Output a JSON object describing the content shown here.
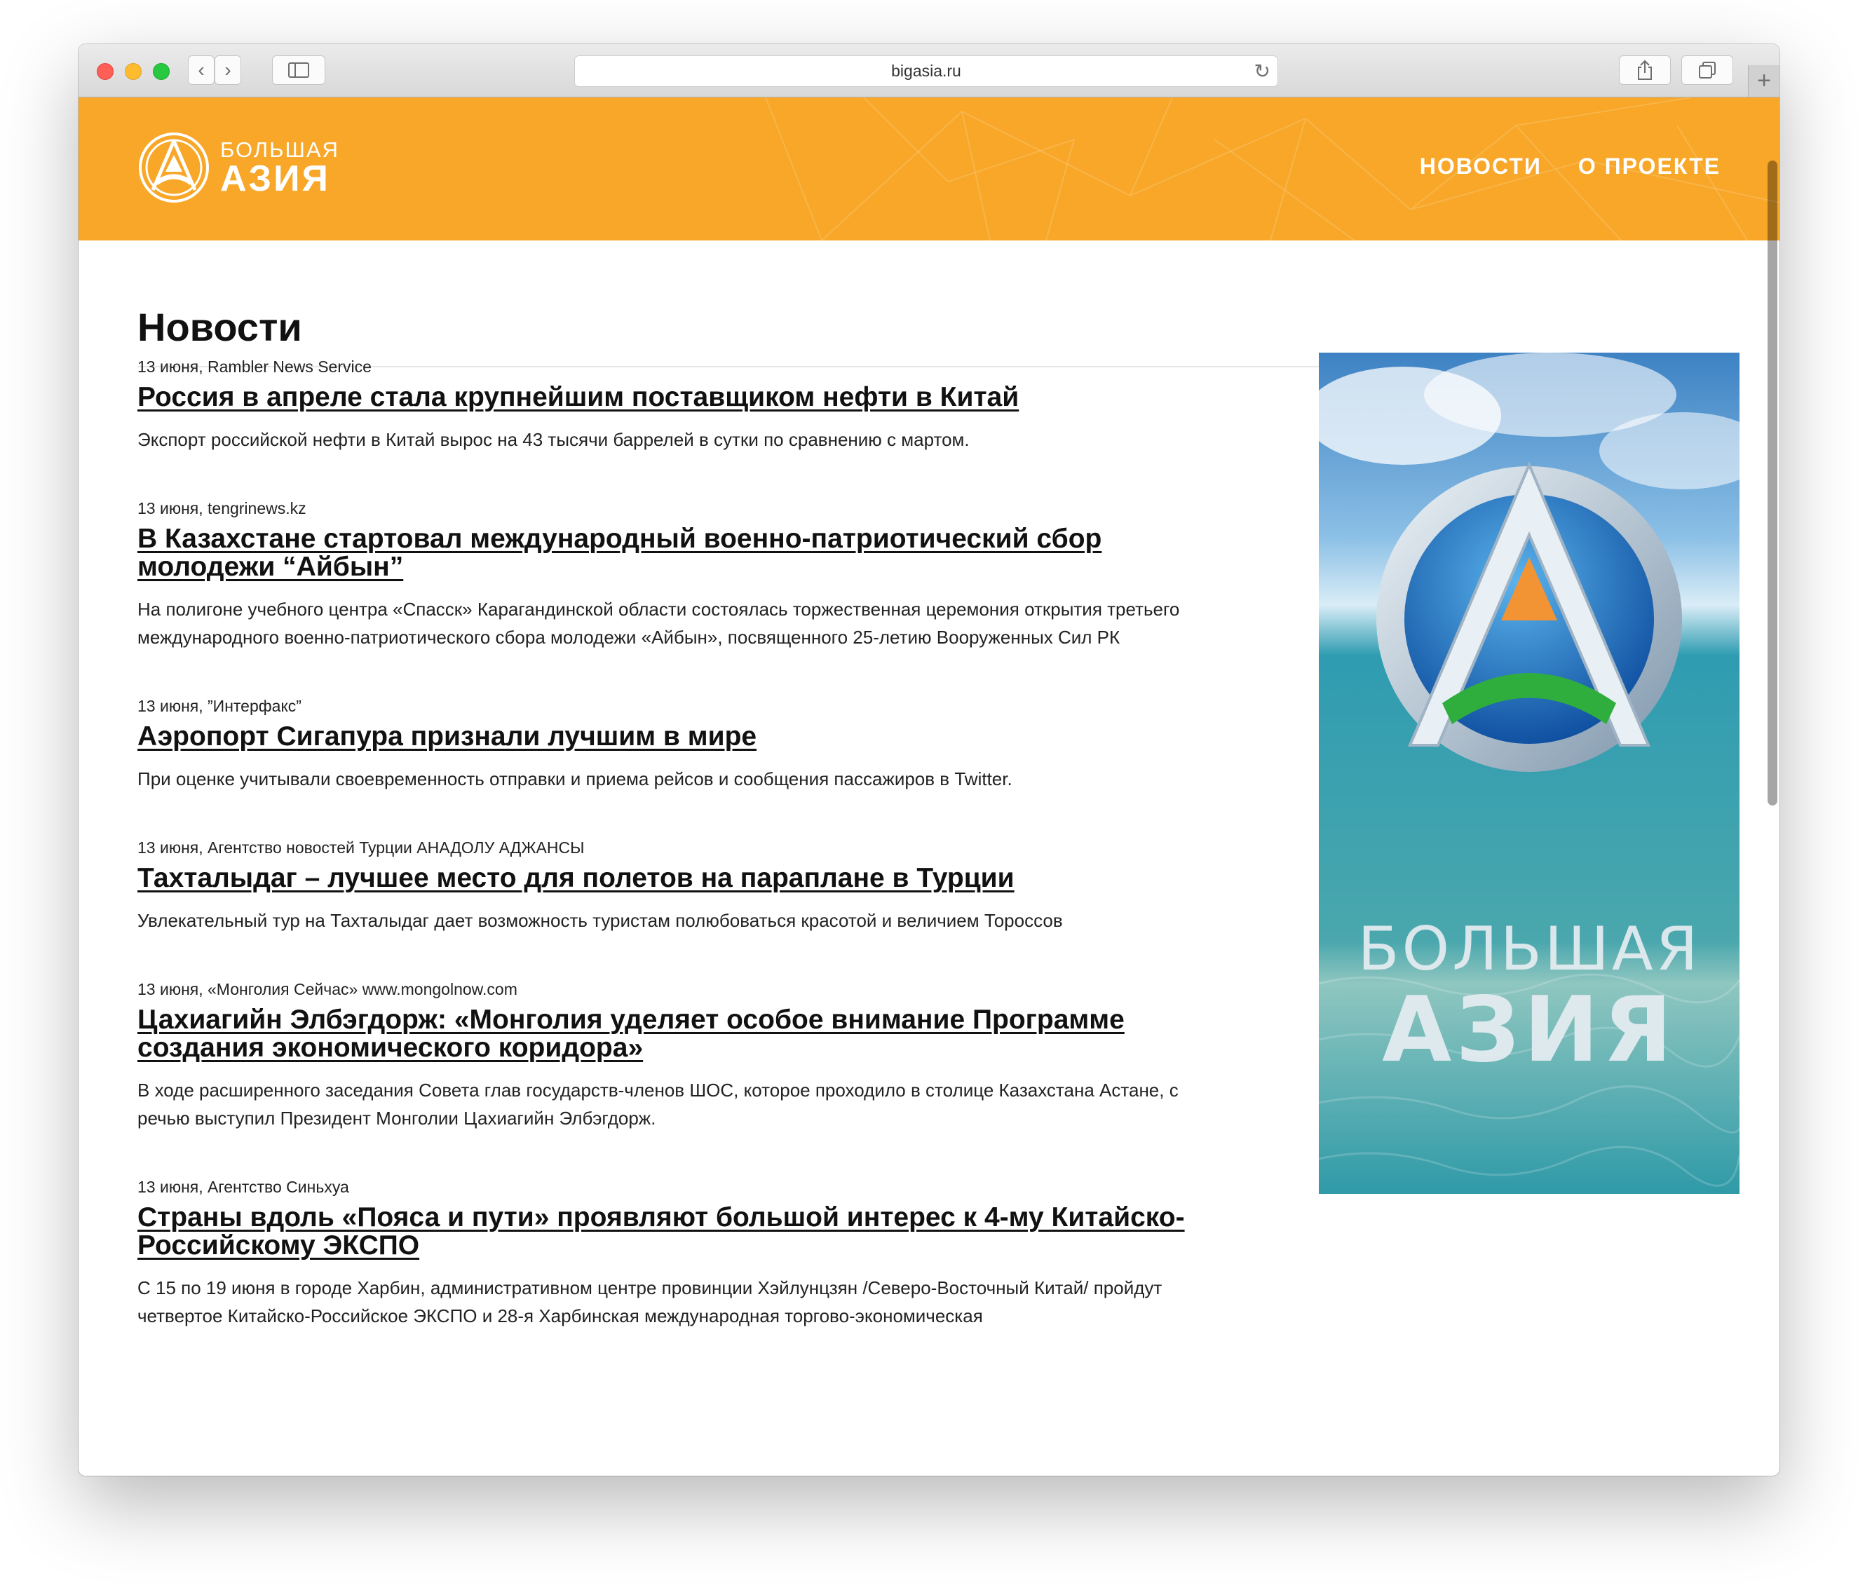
{
  "browser": {
    "url": "bigasia.ru",
    "back_icon": "‹",
    "forward_icon": "›",
    "new_tab_icon": "+"
  },
  "site": {
    "logo": {
      "line1": "БОЛЬШАЯ",
      "line2": "АЗИЯ"
    },
    "nav": [
      {
        "label": "НОВОСТИ"
      },
      {
        "label": "О ПРОЕКТЕ"
      }
    ],
    "brand_color": "#f8a728"
  },
  "main": {
    "title": "Новости",
    "news": [
      {
        "meta": "13 июня, Rambler News Service",
        "title": "Россия в апреле стала крупнейшим поставщиком нефти в Китай",
        "summary": "Экспорт российской нефти в Китай вырос на 43 тысячи баррелей в сутки по сравнению с мартом."
      },
      {
        "meta": "13 июня, tengrinews.kz",
        "title": "В Казахстане стартовал международный военно-патриотический сбор молодежи “Айбын”",
        "summary": "На полигоне учебного центра «Спасск» Карагандинской области состоялась торжественная церемония открытия третьего международного военно-патриотического сбора молодежи «Айбын», посвященного 25-летию Вооруженных Сил РК"
      },
      {
        "meta": "13 июня, ”Интерфакс”",
        "title": "Аэропорт Сигапура признали лучшим в мире",
        "summary": "При оценке учитывали своевременность отправки и приема рейсов и сообщения пассажиров в Twitter."
      },
      {
        "meta": "13 июня, Агентство новостей Турции АНАДОЛУ АДЖАНСЫ",
        "title": "Тахталыдаг – лучшее место для полетов на параплане в Турции",
        "summary": "Увлекательный тур на Тахталыдаг дает возможность туристам полюбоваться красотой и величием Тороссов"
      },
      {
        "meta": "13 июня, «Монголия Сейчас» www.mongolnow.com",
        "title": "Цахиагийн Элбэгдорж: «Монголия уделяет особое внимание Программе создания экономического коридора»",
        "summary": "В ходе расширенного заседания Совета глав государств-членов ШОС, которое проходило в столице Казахстана Астане, с речью выступил Президент Монголии Цахиагийн Элбэгдорж."
      },
      {
        "meta": "13 июня, Агентство Синьхуа",
        "title": "Страны вдоль «Пояса и пути» проявляют большой интерес к 4-му Китайско-Российскому ЭКСПО",
        "summary": "С 15 по 19 июня в городе Харбин, административном центре провинции Хэйлунцзян /Северо-Восточный Китай/ пройдут четвертое Китайско-Российское ЭКСПО и 28-я Харбинская международная торгово-экономическая"
      }
    ]
  },
  "banner": {
    "line1": "БОЛЬШАЯ",
    "line2": "АЗИЯ"
  }
}
